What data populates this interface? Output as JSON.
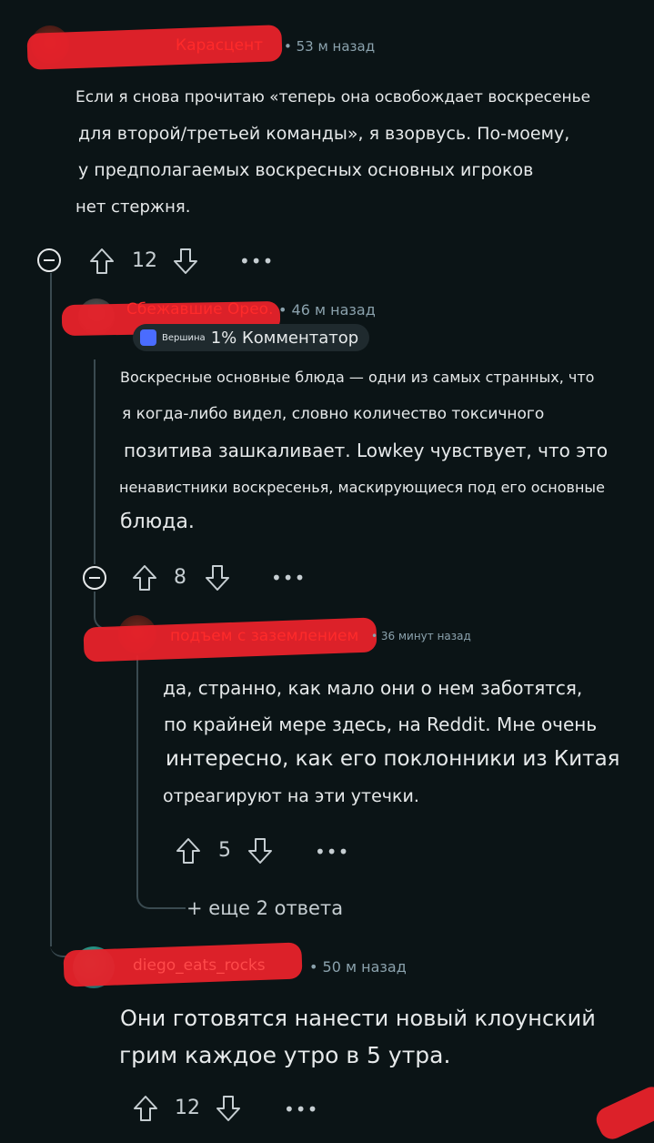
{
  "comments": [
    {
      "username": "Карасцент",
      "time": "• 53 м назад",
      "lines": [
        "Если я снова прочитаю «теперь она освобождает воскресенье",
        "для второй/третьей команды», я взорвусь. По-моему,",
        "у предполагаемых воскресных основных игроков",
        "нет стержня."
      ],
      "votes": "12",
      "more": "•••"
    },
    {
      "username": "Сбежавшие Орео.",
      "time": "• 46 м назад",
      "badge_small": "Вершина",
      "badge": "1% Комментатор",
      "lines": [
        "Воскресные основные блюда — одни из самых странных, что",
        "я когда-либо видел, словно количество токсичного",
        "позитива зашкаливает. Lowkey чувствует, что это",
        "ненавистники воскресенья, маскирующиеся под его основные",
        "блюда."
      ],
      "votes": "8",
      "more": "•••"
    },
    {
      "username": "подъем с заземлением",
      "time": "• 36 минут назад",
      "lines": [
        "да, странно, как мало они о нем заботятся,",
        "по крайней мере здесь, на Reddit. Мне очень",
        "интересно, как его поклонники из Китая",
        "отреагируют на эти утечки."
      ],
      "votes": "5",
      "more": "•••"
    },
    {
      "username": "diego_eats_rocks",
      "time": "• 50 м назад",
      "lines": [
        "Они готовятся нанести новый клоунский",
        "грим каждое утро в 5 утра."
      ],
      "votes": "12",
      "more": "•••"
    }
  ],
  "more_replies": "+ еще 2 ответа",
  "colors": {
    "background": "#0b1416",
    "redaction": "#e8222a",
    "thread": "#3a4a50"
  }
}
